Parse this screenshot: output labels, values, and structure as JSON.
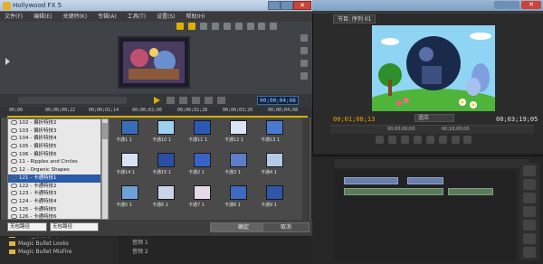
{
  "fx_window": {
    "title": "Hollywood FX 5",
    "menu": [
      "文件(F)",
      "编辑(E)",
      "关键特(K)",
      "专辑(A)",
      "工具(T)",
      "设置(S)",
      "帮助(H)"
    ],
    "timecode": "00;00;04;08",
    "ruler_labels": [
      "00;00",
      "00;00;00;22",
      "00;00;01;14",
      "00;00;02;06",
      "00;00;02;28",
      "00;00;03;20",
      "00;00;04;08"
    ],
    "tree_items": [
      {
        "label": "102 - 偏折特技2",
        "selected": false
      },
      {
        "label": "103 - 偏折特技3",
        "selected": false
      },
      {
        "label": "104 - 偏折特技4",
        "selected": false
      },
      {
        "label": "105 - 偏折特技5",
        "selected": false
      },
      {
        "label": "106 - 偏折特技6",
        "selected": false
      },
      {
        "label": "11 - Ripples and Circles",
        "selected": false
      },
      {
        "label": "12 - Organic Shapes",
        "selected": false
      },
      {
        "label": "121 - 卡通特技1",
        "selected": true
      },
      {
        "label": "122 - 卡通特技2",
        "selected": false
      },
      {
        "label": "123 - 卡通特技3",
        "selected": false
      },
      {
        "label": "124 - 卡通特技4",
        "selected": false
      },
      {
        "label": "125 - 卡通特技5",
        "selected": false
      },
      {
        "label": "126 - 卡通特技6",
        "selected": false
      }
    ],
    "thumbnails": [
      {
        "label": "卡通1 1",
        "color": "#3a6db8"
      },
      {
        "label": "卡通10 1",
        "color": "#9fd0ef"
      },
      {
        "label": "卡通11 1",
        "color": "#2d58b5"
      },
      {
        "label": "卡通12 1",
        "color": "#d8e6f3"
      },
      {
        "label": "卡通13 1",
        "color": "#4a7ad0"
      },
      {
        "label": "卡通14 1",
        "color": "#d7e3f0"
      },
      {
        "label": "卡通15 1",
        "color": "#2c4fa6"
      },
      {
        "label": "卡通2 1",
        "color": "#3a63c4"
      },
      {
        "label": "卡通3 1",
        "color": "#5c7fc8"
      },
      {
        "label": "卡通4 1",
        "color": "#b6c9e4"
      },
      {
        "label": "卡通5 1",
        "color": "#6fa0d8"
      },
      {
        "label": "卡通6 1",
        "color": "#c9d6e8"
      },
      {
        "label": "卡通7 1",
        "color": "#e7d8ea"
      },
      {
        "label": "卡通8 1",
        "color": "#3e6ac0"
      },
      {
        "label": "卡通9 1",
        "color": "#2f56a8"
      }
    ],
    "select_a": "无包路径",
    "select_b": "无包路径",
    "ok_label": "确定",
    "cancel_label": "取消"
  },
  "host": {
    "program_tab": "节目: 序列 01",
    "timecode_current": "00;01;08;13",
    "timecode_total": "00;03;19;05",
    "fit_label": "适应",
    "tc_a": "00;00;00;00",
    "tc_b": "00;16;00;00",
    "project_items": [
      "Knoll_灯光特工厂",
      "Magic Bullet Looks",
      "Magic Bullet MisFire"
    ],
    "track_labels": [
      "音频 1",
      "音频 2"
    ]
  }
}
